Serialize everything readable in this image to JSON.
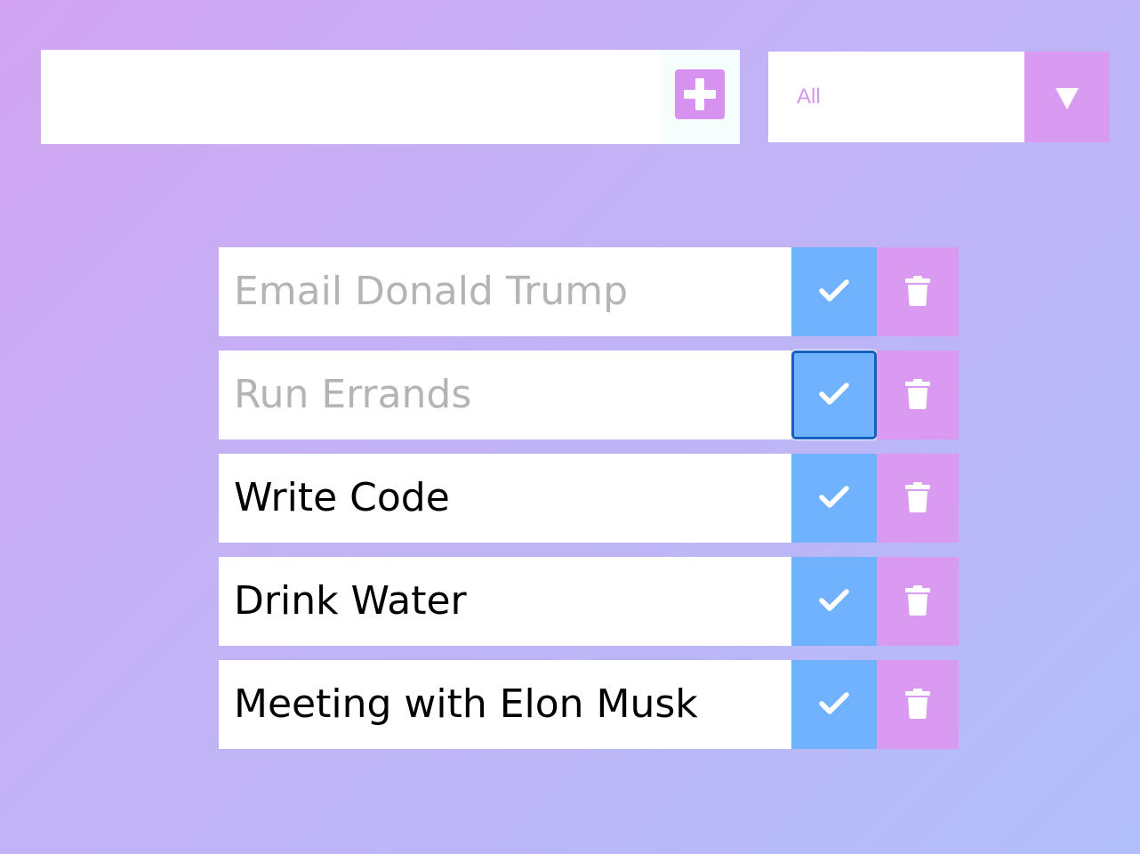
{
  "add_form": {
    "input_value": "",
    "add_button_icon": "plus-icon"
  },
  "filter": {
    "selected": "All",
    "arrow_icon": "triangle-down-icon"
  },
  "todos": [
    {
      "text": "Email Donald Trump",
      "completed": true
    },
    {
      "text": "Run Errands",
      "completed": true
    },
    {
      "text": "Write Code",
      "completed": false
    },
    {
      "text": "Drink Water",
      "completed": false
    },
    {
      "text": "Meeting with Elon Musk",
      "completed": false
    }
  ],
  "colors": {
    "accent_pink": "#d99bf1",
    "check_blue": "#70b2fe",
    "completed_text": "#b4b4b4",
    "focus_ring": "#145fc0"
  }
}
